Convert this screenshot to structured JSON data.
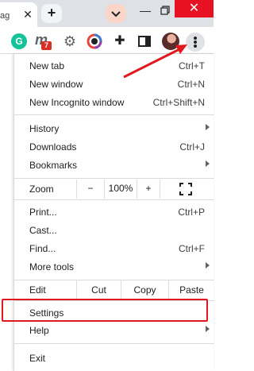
{
  "colors": {
    "highlight_box": "#e0191e",
    "arrow": "#e0191e",
    "window_close": "#e81123",
    "grammarly": "#15c39a",
    "badge": "#d93025"
  },
  "titlebar": {
    "tab_title": "ag",
    "tab_close": "✕",
    "new_tab": "+",
    "tab_search_icon": "chevron-down-icon",
    "minimize": "—",
    "close": "✕"
  },
  "toolbar": {
    "grammarly_letter": "G",
    "m_letter": "m",
    "m_badge": "7",
    "gear_glyph": "⚙",
    "puzzle_glyph": "✚"
  },
  "menu": {
    "new_tab": {
      "label": "New tab",
      "shortcut": "Ctrl+T"
    },
    "new_window": {
      "label": "New window",
      "shortcut": "Ctrl+N"
    },
    "new_incognito": {
      "label": "New Incognito window",
      "shortcut": "Ctrl+Shift+N"
    },
    "history": {
      "label": "History"
    },
    "downloads": {
      "label": "Downloads",
      "shortcut": "Ctrl+J"
    },
    "bookmarks": {
      "label": "Bookmarks"
    },
    "zoom": {
      "label": "Zoom",
      "minus": "−",
      "level": "100%",
      "plus": "+"
    },
    "print": {
      "label": "Print...",
      "shortcut": "Ctrl+P"
    },
    "cast": {
      "label": "Cast..."
    },
    "find": {
      "label": "Find...",
      "shortcut": "Ctrl+F"
    },
    "more_tools": {
      "label": "More tools"
    },
    "edit": {
      "label": "Edit",
      "cut": "Cut",
      "copy": "Copy",
      "paste": "Paste"
    },
    "settings": {
      "label": "Settings"
    },
    "help": {
      "label": "Help"
    },
    "exit": {
      "label": "Exit"
    }
  }
}
